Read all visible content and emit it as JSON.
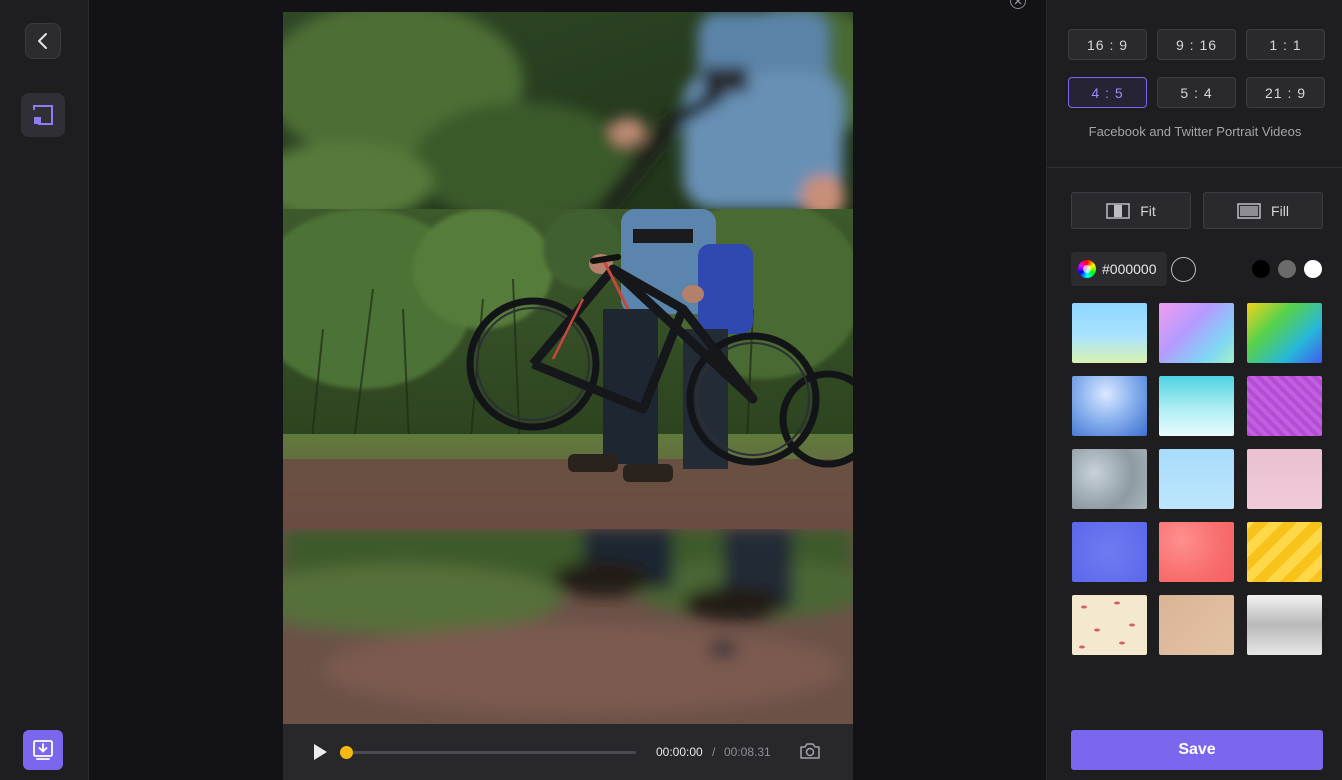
{
  "rail": {
    "back_icon": "chevron-left-icon",
    "crop_icon": "crop-icon",
    "export_icon": "download-icon"
  },
  "player": {
    "current_time": "00:00:00",
    "separator": "/",
    "total_time": "00:08.31",
    "progress": 0.0
  },
  "ratios": [
    {
      "label": "16 : 9",
      "active": false
    },
    {
      "label": "9 : 16",
      "active": false
    },
    {
      "label": "1 : 1",
      "active": false
    },
    {
      "label": "4 : 5",
      "active": true
    },
    {
      "label": "5 : 4",
      "active": false
    },
    {
      "label": "21 : 9",
      "active": false
    }
  ],
  "ratio_description": "Facebook and Twitter Portrait Videos",
  "modes": {
    "fit_label": "Fit",
    "fill_label": "Fill"
  },
  "color": {
    "value": "#000000",
    "presets": [
      "#000000",
      "#6b6b6b",
      "#ffffff"
    ]
  },
  "save_label": "Save",
  "accent": "#7b66ee"
}
